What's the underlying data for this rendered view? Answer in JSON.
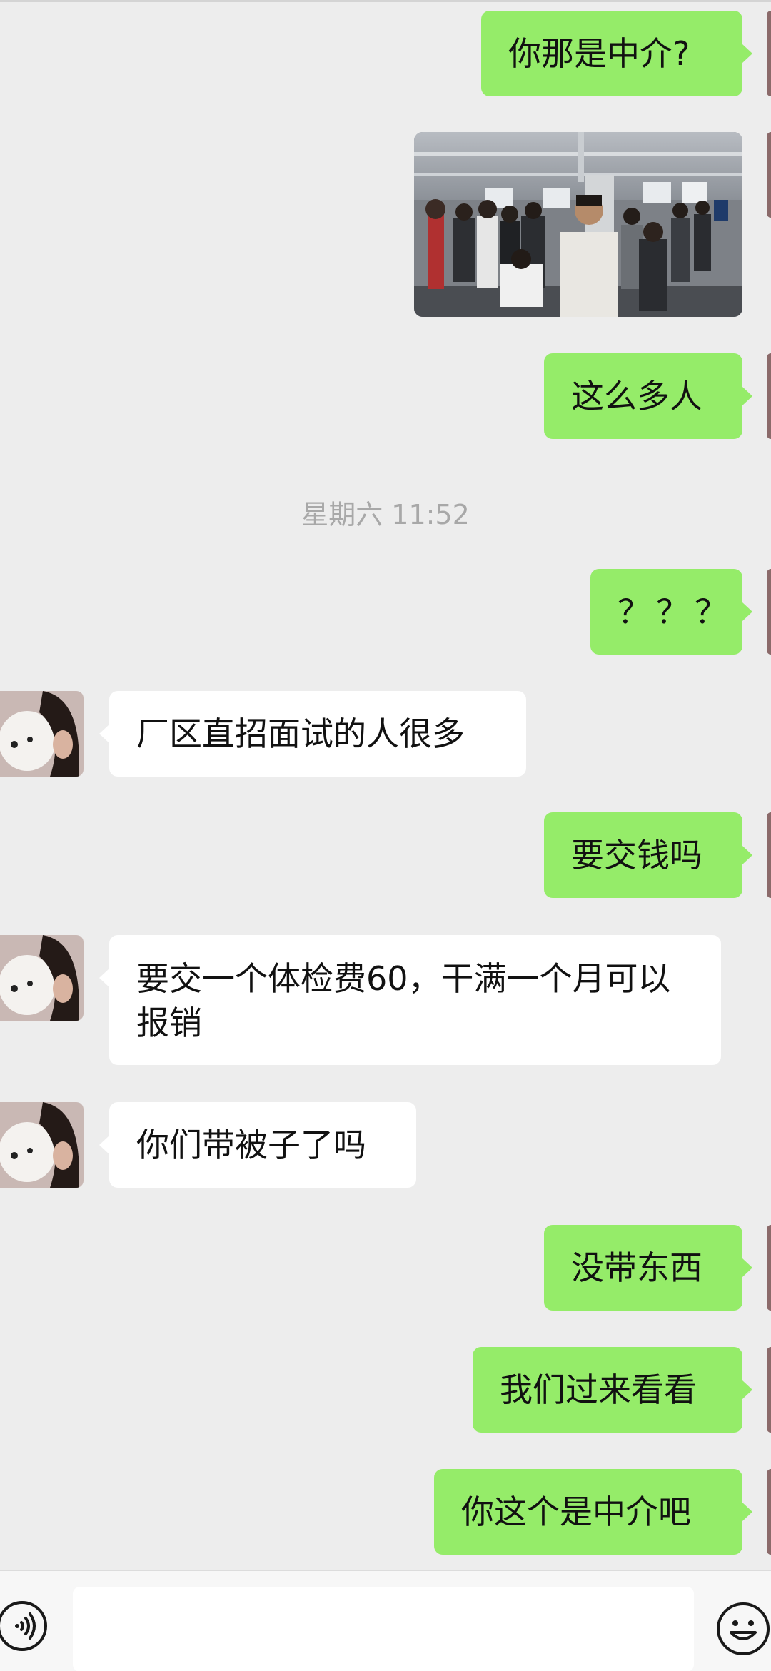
{
  "timestamp": "星期六 11:52",
  "messages": [
    {
      "sender": "self",
      "text": "你那是中介?"
    },
    {
      "sender": "self",
      "type": "image",
      "description": ""
    },
    {
      "sender": "self",
      "text": "这么多人"
    },
    {
      "sender": "self",
      "text": "？？？"
    },
    {
      "sender": "other",
      "text": "厂区直招面试的人很多"
    },
    {
      "sender": "self",
      "text": "要交钱吗"
    },
    {
      "sender": "other",
      "text": "要交一个体检费60，干满一个月可以报销"
    },
    {
      "sender": "other",
      "text": "你们带被子了吗"
    },
    {
      "sender": "self",
      "text": "没带东西"
    },
    {
      "sender": "self",
      "text": "我们过来看看"
    },
    {
      "sender": "self",
      "text": "你这个是中介吧"
    }
  ],
  "input": {
    "value": "",
    "placeholder": ""
  },
  "icons": {
    "voice": "voice-toggle-icon",
    "emoji": "emoji-icon"
  },
  "colors": {
    "background": "#ededed",
    "outgoing_bubble": "#95ec69",
    "incoming_bubble": "#ffffff",
    "timestamp_text": "#a8a8a8"
  }
}
